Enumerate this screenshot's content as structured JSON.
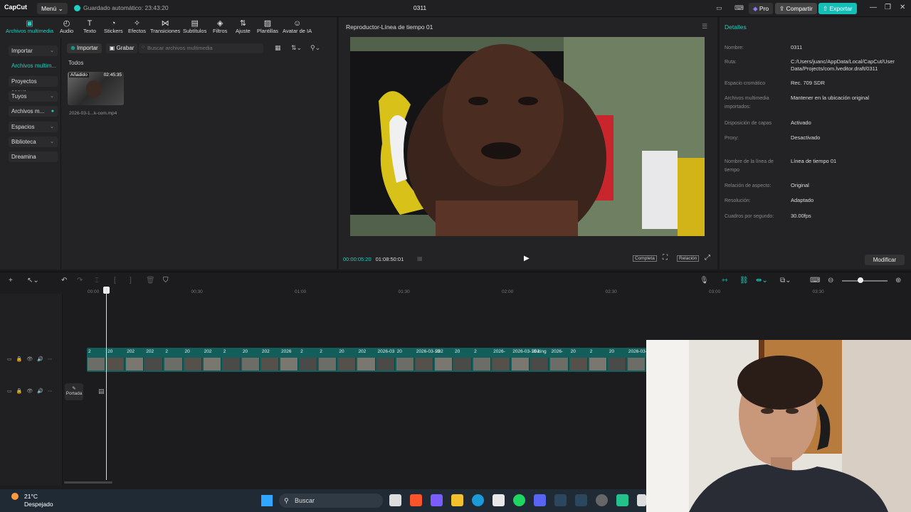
{
  "titlebar": {
    "app_name": "CapCut",
    "menu_label": "Menú",
    "autosave_text": "Guardado automático: 23:43:20",
    "project_title": "0311",
    "pro_label": "Pro",
    "share_label": "Compartir",
    "export_label": "Exportar"
  },
  "toolbar": {
    "items": [
      {
        "label": "Archivos multimedia",
        "icon": "media-icon"
      },
      {
        "label": "Audio",
        "icon": "audio-icon"
      },
      {
        "label": "Texto",
        "icon": "text-icon"
      },
      {
        "label": "Stickers",
        "icon": "sticker-icon"
      },
      {
        "label": "Efectos",
        "icon": "effects-icon"
      },
      {
        "label": "Transiciones",
        "icon": "transitions-icon"
      },
      {
        "label": "Subtítulos",
        "icon": "subtitles-icon"
      },
      {
        "label": "Filtros",
        "icon": "filters-icon"
      },
      {
        "label": "Ajuste",
        "icon": "adjust-icon"
      },
      {
        "label": "Plantillas",
        "icon": "templates-icon"
      },
      {
        "label": "Avatar de IA",
        "icon": "ai-avatar-icon"
      }
    ]
  },
  "sidebar": {
    "items": [
      {
        "label": "Importar"
      },
      {
        "label": "Archivos multim..."
      },
      {
        "label": "Proyectos secun..."
      },
      {
        "label": "Tuyos"
      },
      {
        "label": "Archivos m..."
      },
      {
        "label": "Espacios"
      },
      {
        "label": "Biblioteca"
      },
      {
        "label": "Dreamina"
      }
    ]
  },
  "media": {
    "import_label": "Importar",
    "record_label": "Grabar",
    "search_placeholder": "Buscar archivos multimedia",
    "section_label": "Todos",
    "file": {
      "badge": "Añadido",
      "duration": "02:45:35",
      "name": "2026-03-1...k-com.mp4"
    }
  },
  "player": {
    "title": "Reproductor-Línea de tiempo 01",
    "current_time": "00:00:05:20",
    "total_time": "01:08:50:01",
    "full_label": "Completa",
    "ratio_label": "Relación"
  },
  "details": {
    "title": "Detalles",
    "rows": [
      {
        "label": "Nombre:",
        "value": "0311"
      },
      {
        "label": "Ruta:",
        "value": "C:/Users/juanc/AppData/Local/CapCut/User Data/Projects/com.lveditor.draft/0311"
      },
      {
        "label": "Espacio cromático",
        "value": "Rec. 709 SDR"
      },
      {
        "label": "Archivos multimedia importados:",
        "value": "Mantener en la ubicación original"
      },
      {
        "label": "Disposición de capas",
        "value": "Activado"
      },
      {
        "label": "Proxy:",
        "value": "Desactivado"
      },
      {
        "label": "Nombre de la línea de tiempo",
        "value": "Línea de tiempo 01"
      },
      {
        "label": "Relación de aspecto:",
        "value": "Original"
      },
      {
        "label": "Resolución:",
        "value": "Adaptado"
      },
      {
        "label": "Cuadros por segundo:",
        "value": "30.00fps"
      }
    ],
    "modify_label": "Modificar"
  },
  "timeline": {
    "ruler": [
      "00:00",
      "00:30",
      "01:00",
      "01:30",
      "02:00",
      "02:30",
      "03:00",
      "03:30"
    ],
    "clip_labels": [
      "2",
      "20",
      "202",
      "202",
      "2",
      "20",
      "202",
      "2",
      "20",
      "202",
      "2026",
      "2",
      "2",
      "20",
      "202",
      "2026-03",
      "20",
      "2026-03-10",
      "202",
      "20",
      "2",
      "2026-",
      "2026-03-10-king",
      "202",
      "2026-",
      "20",
      "2",
      "20",
      "2026-03-10"
    ],
    "cover_label": "Portada"
  },
  "taskbar": {
    "temperature": "21°C",
    "weather": "Despejado",
    "search_label": "Buscar"
  },
  "colors": {
    "accent": "#1fd0c2",
    "clip": "#135d5a",
    "panel": "#232325"
  }
}
